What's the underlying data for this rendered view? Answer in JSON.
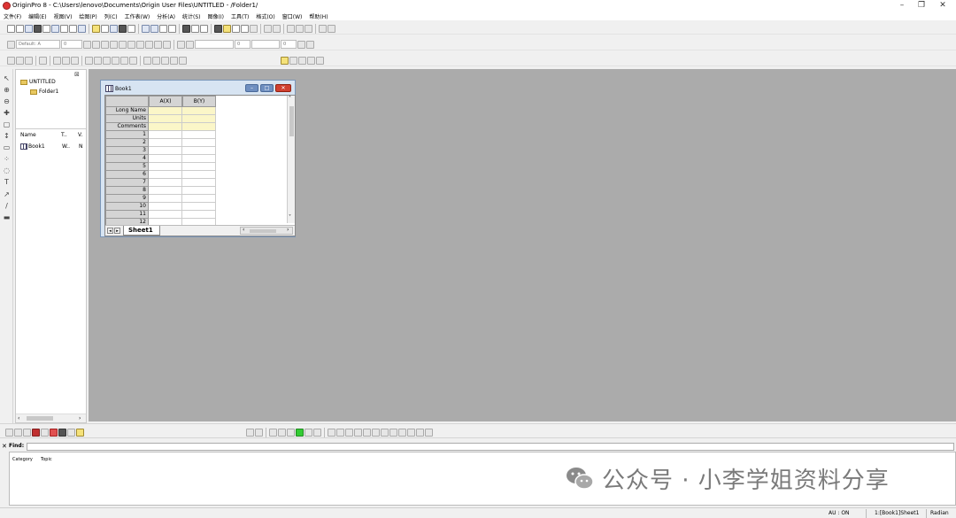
{
  "window": {
    "title": "OriginPro 8 - C:\\Users\\lenovo\\Documents\\Origin User Files\\UNTITLED - /Folder1/"
  },
  "menu": [
    "文件(F)",
    "编辑(E)",
    "视图(V)",
    "绘图(P)",
    "列(C)",
    "工作表(W)",
    "分析(A)",
    "统计(S)",
    "图像(I)",
    "工具(T)",
    "格式(O)",
    "窗口(W)",
    "帮助(H)"
  ],
  "format_toolbar": {
    "font": "Default: A",
    "size": "0",
    "line_width": "0",
    "fill_size": "0"
  },
  "project_explorer": {
    "root": "UNTITLED",
    "folder": "Folder1",
    "columns": [
      "Name",
      "T..",
      "V."
    ],
    "items": [
      {
        "name": "Book1",
        "type": "W..",
        "view": "N"
      }
    ]
  },
  "book": {
    "title": "Book1",
    "columns": [
      "A(X)",
      "B(Y)"
    ],
    "header_rows": [
      "Long Name",
      "Units",
      "Comments"
    ],
    "rows": [
      "1",
      "2",
      "3",
      "4",
      "5",
      "6",
      "7",
      "8",
      "9",
      "10",
      "11",
      "12"
    ],
    "sheet_tab": "Sheet1"
  },
  "find": {
    "label": "Find:"
  },
  "help": {
    "col_category": "Category",
    "col_topic": "Topic"
  },
  "status": {
    "au": "AU : ON",
    "active": "1:[Book1]Sheet1",
    "angle": "Radian"
  },
  "watermark": {
    "text": "公众号 · 小李学姐资料分享"
  }
}
